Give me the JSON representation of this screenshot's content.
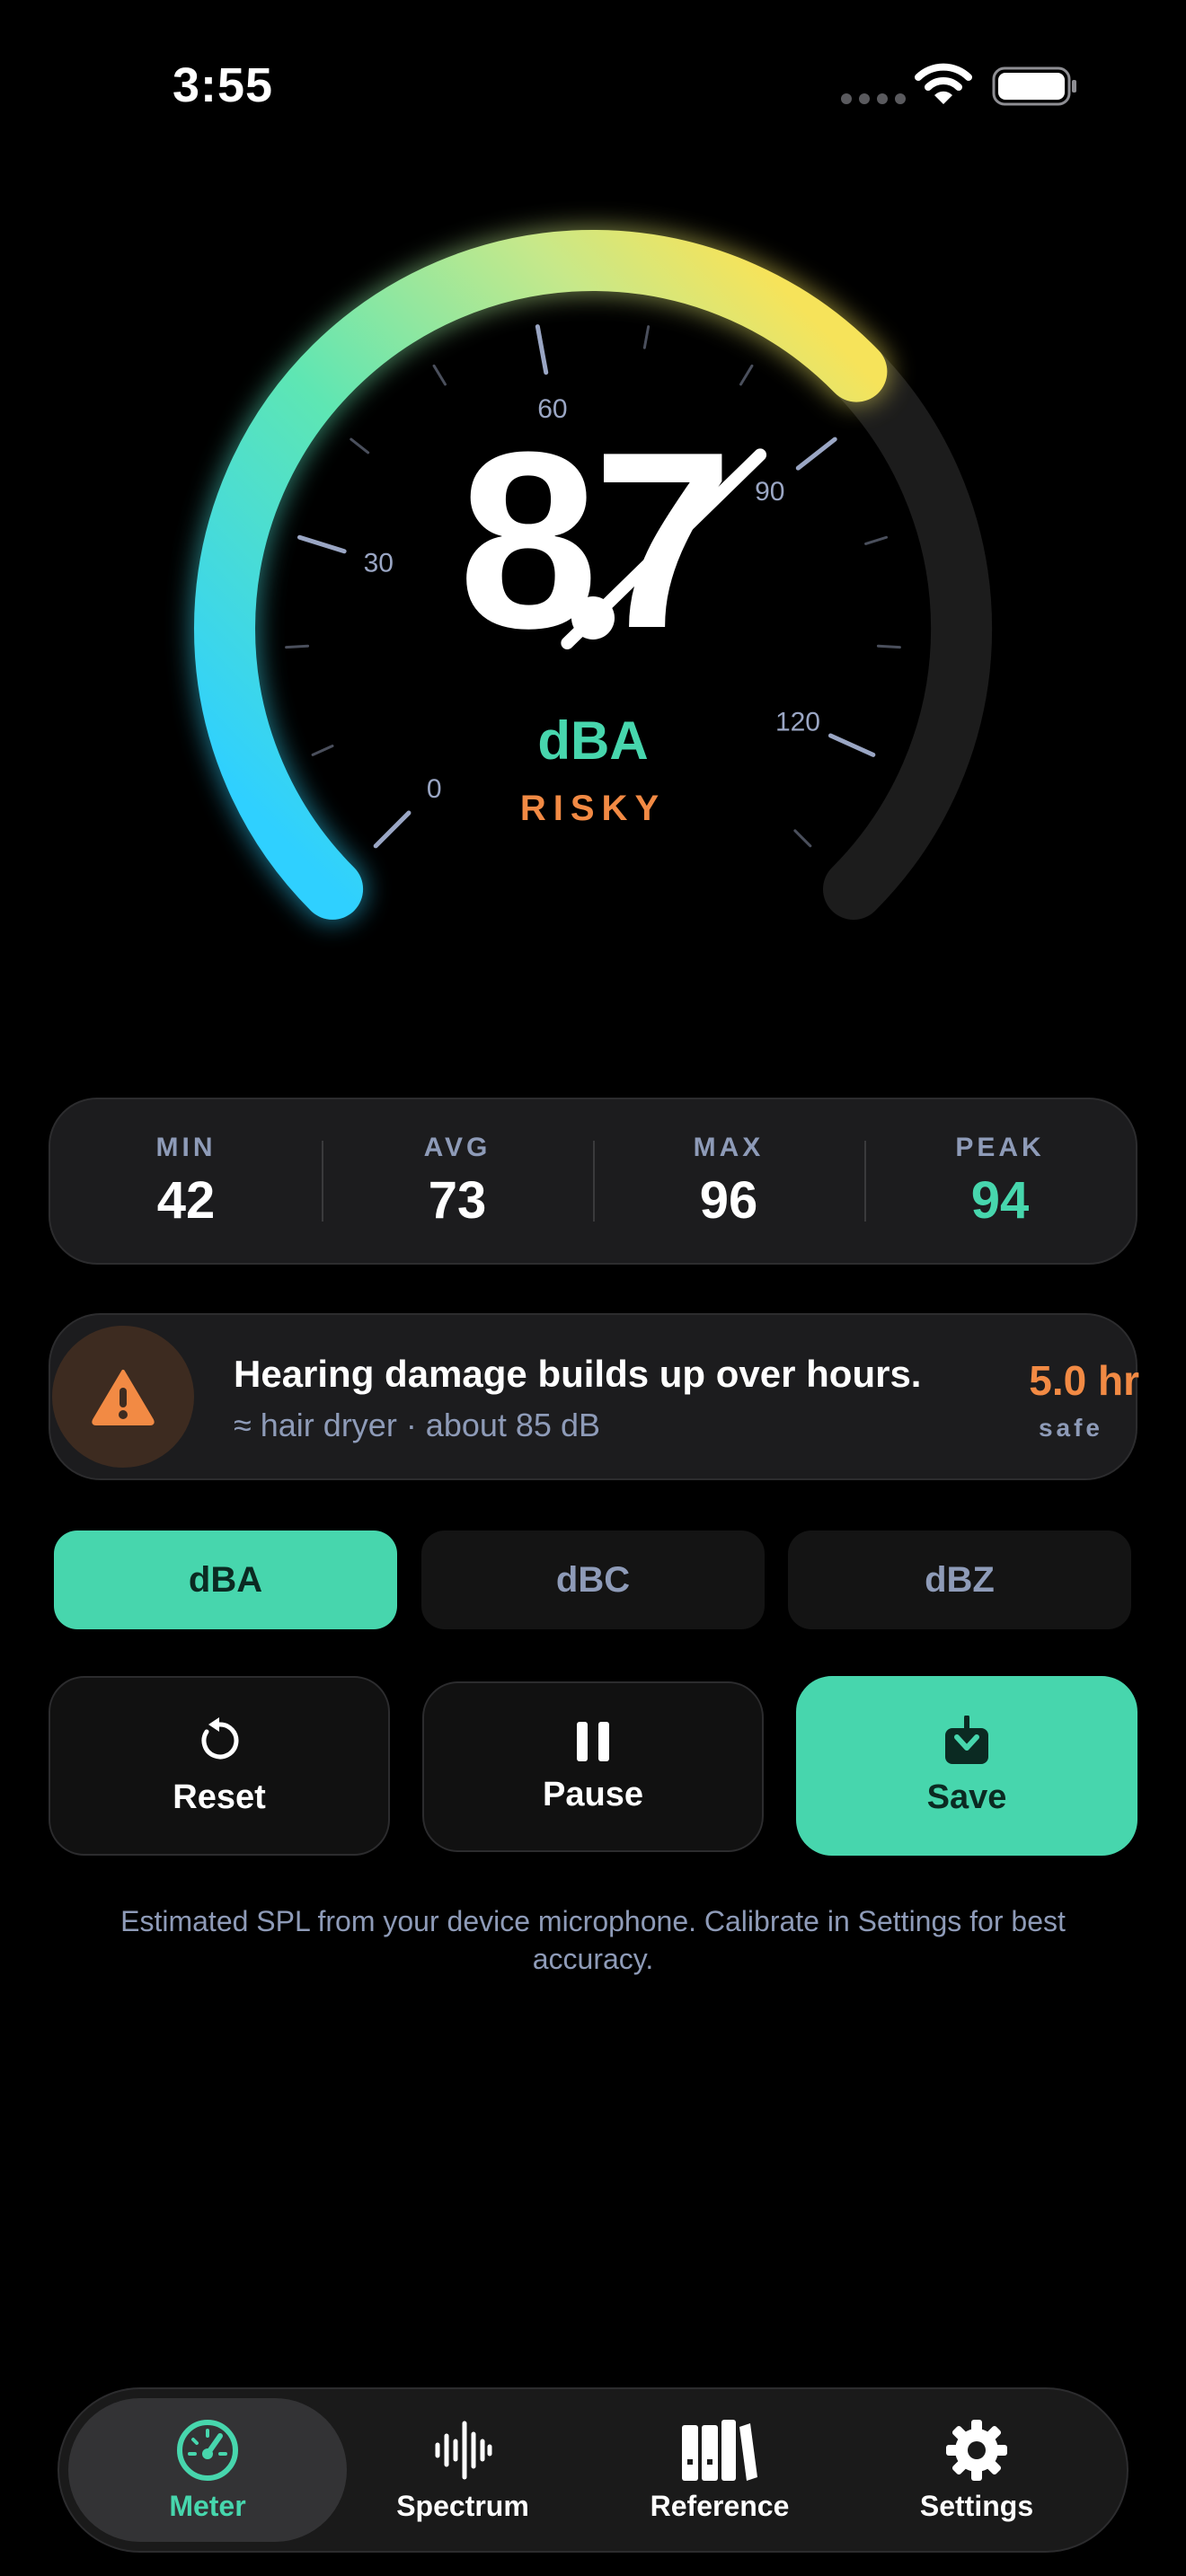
{
  "status_bar": {
    "time": "3:55"
  },
  "gauge": {
    "value": "87",
    "unit": "dBA",
    "status": "RISKY",
    "tick_labels": [
      "0",
      "30",
      "60",
      "90",
      "120"
    ],
    "level_db": 87,
    "range_db": [
      0,
      130
    ]
  },
  "stats": [
    {
      "label": "MIN",
      "value": "42"
    },
    {
      "label": "AVG",
      "value": "73"
    },
    {
      "label": "MAX",
      "value": "96"
    },
    {
      "label": "PEAK",
      "value": "94"
    }
  ],
  "warning": {
    "title": "Hearing damage builds up over hours.",
    "subtitle": "≈ hair dryer · about 85 dB",
    "hours": "5.0 hr",
    "hours_label": "safe",
    "icon": "warning-triangle-icon"
  },
  "weightings": [
    "dBA",
    "dBC",
    "dBZ"
  ],
  "actions": {
    "reset": "Reset",
    "pause": "Pause",
    "save": "Save"
  },
  "footnote": "Estimated SPL from your device microphone. Calibrate in Settings for best accuracy.",
  "tabs": [
    {
      "label": "Meter",
      "icon": "gauge-icon"
    },
    {
      "label": "Spectrum",
      "icon": "waveform-icon"
    },
    {
      "label": "Reference",
      "icon": "books-icon"
    },
    {
      "label": "Settings",
      "icon": "gear-icon"
    }
  ],
  "colors": {
    "accent": "#47d6ad",
    "warning": "#f28a44",
    "muted": "#8e9bb8"
  }
}
